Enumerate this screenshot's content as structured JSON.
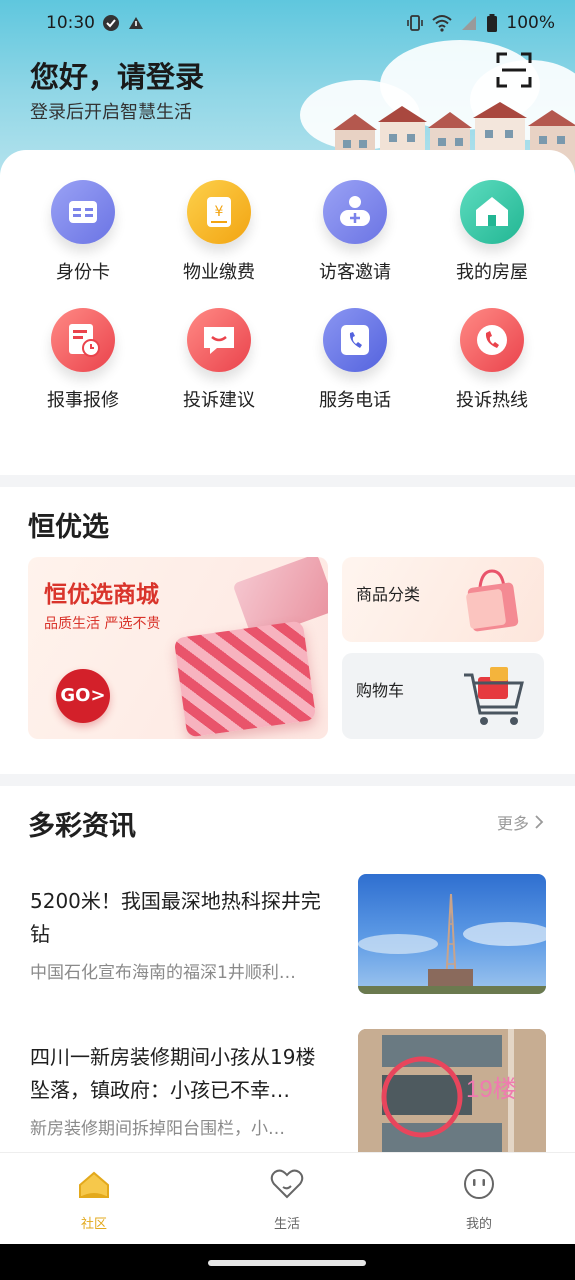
{
  "status_bar": {
    "time": "10:30",
    "battery": "100%"
  },
  "header": {
    "title": "您好，请登录",
    "subtitle": "登录后开启智慧生活"
  },
  "services": [
    {
      "label": "身份卡",
      "icon": "id-card-icon",
      "color": "#7b83ea"
    },
    {
      "label": "物业缴费",
      "icon": "payment-icon",
      "color": "#f6b21e"
    },
    {
      "label": "访客邀请",
      "icon": "visitor-icon",
      "color": "#7b83ea"
    },
    {
      "label": "我的房屋",
      "icon": "house-icon",
      "color": "#2ec7a6"
    },
    {
      "label": "报事报修",
      "icon": "repair-icon",
      "color": "#f0545b"
    },
    {
      "label": "投诉建议",
      "icon": "complaint-icon",
      "color": "#f0545b"
    },
    {
      "label": "服务电话",
      "icon": "service-phone-icon",
      "color": "#6c7ae8"
    },
    {
      "label": "投诉热线",
      "icon": "hotline-icon",
      "color": "#f0545b"
    }
  ],
  "shop": {
    "section_title": "恒优选",
    "banner_title": "恒优选商城",
    "banner_sub": "品质生活 严选不贵",
    "go_label": "GO>",
    "category_label": "商品分类",
    "cart_label": "购物车"
  },
  "news": {
    "section_title": "多彩资讯",
    "more_label": "更多",
    "items": [
      {
        "title": "5200米！我国最深地热科探井完钻",
        "desc": "中国石化宣布海南的福深1井顺利…"
      },
      {
        "title": "四川一新房装修期间小孩从19楼坠落，镇政府：小孩已不幸…",
        "desc": "新房装修期间拆掉阳台围栏，小…",
        "image_caption": "19楼"
      }
    ]
  },
  "bottom_nav": [
    {
      "label": "社区",
      "icon": "community-icon",
      "active": true
    },
    {
      "label": "生活",
      "icon": "heart-icon",
      "active": false
    },
    {
      "label": "我的",
      "icon": "smiley-icon",
      "active": false
    }
  ],
  "colors": {
    "accent": "#e3a91c",
    "brand_red": "#d9342b"
  }
}
